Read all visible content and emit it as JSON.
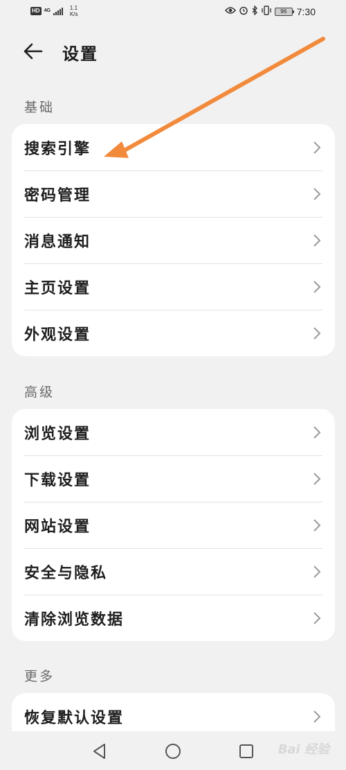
{
  "status_bar": {
    "hd": "HD",
    "network": "4G",
    "speed_value": "1.1",
    "speed_unit": "K/s",
    "battery": "96",
    "time": "7:30",
    "icons": [
      "eye-icon",
      "alarm-icon",
      "bluetooth-icon",
      "vibrate-icon",
      "battery-icon"
    ]
  },
  "header": {
    "title": "设置",
    "back_icon": "back-arrow-icon"
  },
  "sections": [
    {
      "label": "基础",
      "items": [
        {
          "label": "搜索引擎"
        },
        {
          "label": "密码管理"
        },
        {
          "label": "消息通知"
        },
        {
          "label": "主页设置"
        },
        {
          "label": "外观设置"
        }
      ]
    },
    {
      "label": "高级",
      "items": [
        {
          "label": "浏览设置"
        },
        {
          "label": "下载设置"
        },
        {
          "label": "网站设置"
        },
        {
          "label": "安全与隐私"
        },
        {
          "label": "清除浏览数据"
        }
      ]
    },
    {
      "label": "更多",
      "items": [
        {
          "label": "恢复默认设置"
        }
      ]
    }
  ],
  "annotation": {
    "color": "#f28a3c"
  },
  "nav_bar": {
    "icons": [
      "back-triangle-icon",
      "home-circle-icon",
      "recents-square-icon"
    ],
    "watermark": "Bai 经验"
  }
}
